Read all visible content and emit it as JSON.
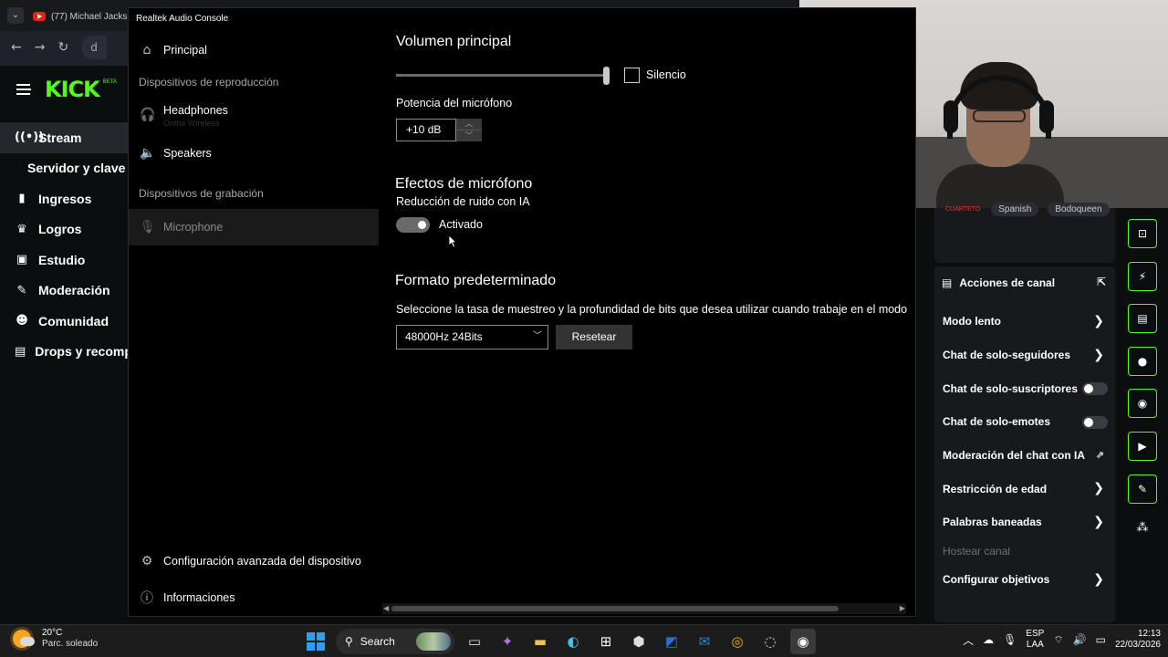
{
  "browser": {
    "tab_title": "(77) Michael Jacks",
    "omnibox_stub": "d"
  },
  "kick": {
    "logo": "KICK",
    "beta": "BETA",
    "menu": [
      {
        "label": "Stream",
        "icon": "radio-icon",
        "glyph": "((•))",
        "active": true,
        "sub": false
      },
      {
        "label": "Servidor y clave d",
        "icon": "",
        "glyph": "",
        "active": false,
        "sub": true
      },
      {
        "label": "Ingresos",
        "icon": "chart-icon",
        "glyph": "▮",
        "active": false,
        "sub": false
      },
      {
        "label": "Logros",
        "icon": "trophy-icon",
        "glyph": "♛",
        "active": false,
        "sub": false
      },
      {
        "label": "Estudio",
        "icon": "studio-icon",
        "glyph": "▣",
        "active": false,
        "sub": false
      },
      {
        "label": "Moderación",
        "icon": "wrench-icon",
        "glyph": "✎",
        "active": false,
        "sub": false
      },
      {
        "label": "Comunidad",
        "icon": "community-icon",
        "glyph": "☻",
        "active": false,
        "sub": false
      },
      {
        "label": "Drops y recomp",
        "icon": "drops-icon",
        "glyph": "▤",
        "active": false,
        "sub": false
      }
    ]
  },
  "realtek": {
    "window_title": "Realtek Audio Console",
    "nav": {
      "principal": "Principal",
      "playback_section": "Dispositivos de reproducción",
      "headphones": "Headphones",
      "headphones_sub": "Onthe Wireless",
      "speakers": "Speakers",
      "recording_section": "Dispositivos de grabación",
      "microphone": "Microphone",
      "advanced": "Configuración avanzada del dispositivo",
      "info": "Informaciones"
    },
    "main": {
      "volume_heading": "Volumen principal",
      "volume_level": 1.0,
      "mute_label": "Silencio",
      "mute_checked": false,
      "mic_boost_label": "Potencia del micrófono",
      "mic_boost_value": "+10 dB",
      "effects_heading": "Efectos de micrófono",
      "noise_label": "Reducción de ruido con IA",
      "noise_state": "Activado",
      "noise_on": true,
      "format_heading": "Formato predeterminado",
      "format_desc": "Seleccione la tasa de muestreo y la profundidad de bits que desea utilizar cuando trabaje en el modo",
      "format_value": "48000Hz 24Bits",
      "reset_label": "Resetear"
    }
  },
  "chat_panel": {
    "tags": [
      "CUARTETO",
      "Spanish",
      "Bodoqueen"
    ],
    "actions_title": "Acciones de canal",
    "actions": [
      {
        "label": "Modo lento",
        "control": "chevron"
      },
      {
        "label": "Chat de solo-seguidores",
        "control": "chevron"
      },
      {
        "label": "Chat de solo-suscriptores",
        "control": "switch"
      },
      {
        "label": "Chat de solo-emotes",
        "control": "switch"
      },
      {
        "label": "Moderación del chat con IA",
        "control": "external"
      },
      {
        "label": "Restricción de edad",
        "control": "chevron"
      },
      {
        "label": "Palabras baneadas",
        "control": "chevron"
      },
      {
        "label": "Hostear canal",
        "control": "disabled"
      },
      {
        "label": "Configurar objetivos",
        "control": "chevron"
      }
    ]
  },
  "taskbar": {
    "temperature": "20°C",
    "weather": "Parc. soleado",
    "search": "Search",
    "lang_top": "ESP",
    "lang_bottom": "LAA",
    "time": "12:13",
    "date": "22/03/2026"
  },
  "colors": {
    "kick_green": "#53fc18",
    "windows_blue": "#2b9ff4"
  }
}
